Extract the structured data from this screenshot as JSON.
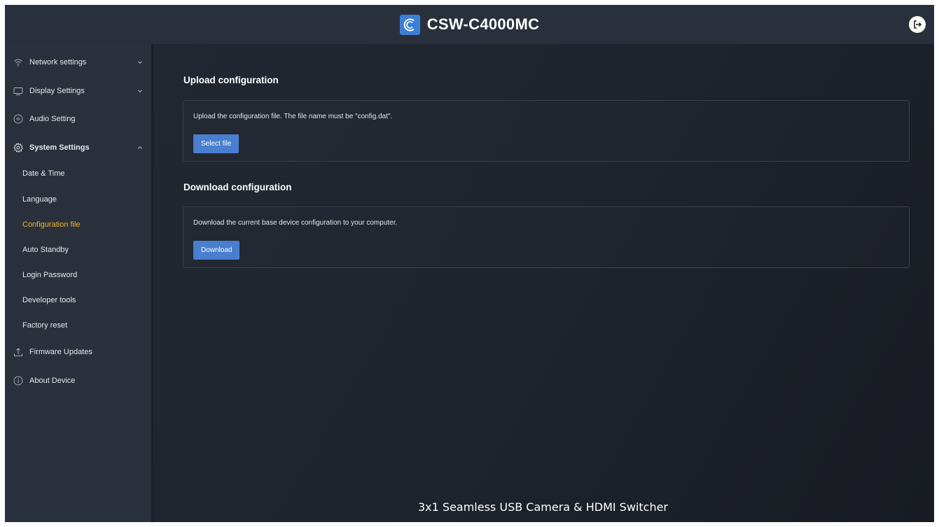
{
  "header": {
    "title": "CSW-C4000MC",
    "logout_icon": "logout-icon"
  },
  "sidebar": {
    "items": [
      {
        "label": "Network settings",
        "icon": "wifi-icon",
        "chevron": "down"
      },
      {
        "label": "Display Settings",
        "icon": "monitor-icon",
        "chevron": "down"
      },
      {
        "label": "Audio Setting",
        "icon": "audio-icon"
      },
      {
        "label": "System Settings",
        "icon": "gear-icon",
        "chevron": "up",
        "expanded": true
      },
      {
        "label": "Firmware Updates",
        "icon": "upload-icon"
      },
      {
        "label": "About Device",
        "icon": "info-icon"
      }
    ],
    "sub_items": [
      {
        "label": "Date & Time"
      },
      {
        "label": "Language"
      },
      {
        "label": "Configuration file",
        "active": true
      },
      {
        "label": "Auto Standby"
      },
      {
        "label": "Login Password"
      },
      {
        "label": "Developer tools"
      },
      {
        "label": "Factory reset"
      }
    ]
  },
  "main": {
    "upload": {
      "title": "Upload configuration",
      "description": "Upload the configuration file. The file name must be \"config.dat\".",
      "button": "Select file"
    },
    "download": {
      "title": "Download configuration",
      "description": "Download the current base device configuration to your computer.",
      "button": "Download"
    }
  },
  "footer": {
    "text": "3x1 Seamless USB Camera & HDMI Switcher"
  },
  "colors": {
    "accent": "#4a7fcf",
    "active_item": "#f2b41f",
    "logo": "#3d7ed8"
  }
}
